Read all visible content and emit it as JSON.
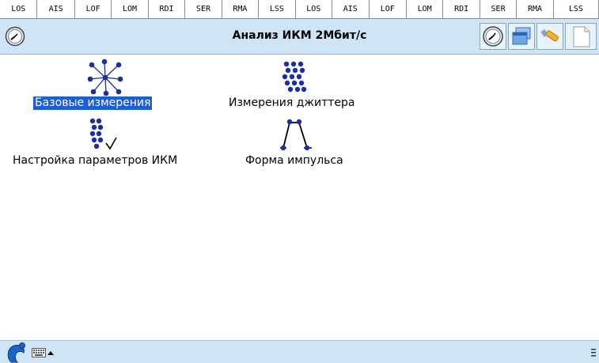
{
  "status_bar": {
    "cells": [
      "LOS",
      "AIS",
      "LOF",
      "LOM",
      "RDI",
      "SER",
      "RMA",
      "LSS",
      "LOS",
      "AIS",
      "LOF",
      "LOM",
      "RDI",
      "SER",
      "RMA",
      "LSS"
    ]
  },
  "title_bar": {
    "title": "Анализ ИКМ 2Мбит/с",
    "left_icon": "clock-icon",
    "right_buttons": [
      "clock-icon",
      "windows-icon",
      "tools-icon",
      "document-icon"
    ]
  },
  "launchers": [
    {
      "label": "Базовые измерения",
      "icon": "star-network-icon",
      "selected": true
    },
    {
      "label": "Измерения джиттера",
      "icon": "dot-grid-icon",
      "selected": false
    },
    {
      "label": "Настройка параметров ИКМ",
      "icon": "dots-check-icon",
      "selected": false
    },
    {
      "label": "Форма импульса",
      "icon": "pulse-shape-icon",
      "selected": false
    }
  ],
  "taskbar": {
    "start_icon": "start-icon",
    "keyboard_icon": "keyboard-icon",
    "menu_icon": "menu-icon"
  },
  "colors": {
    "title_bg": "#cfe4f6",
    "selection": "#1d5ed8",
    "icon_blue": "#1a2fa0"
  }
}
